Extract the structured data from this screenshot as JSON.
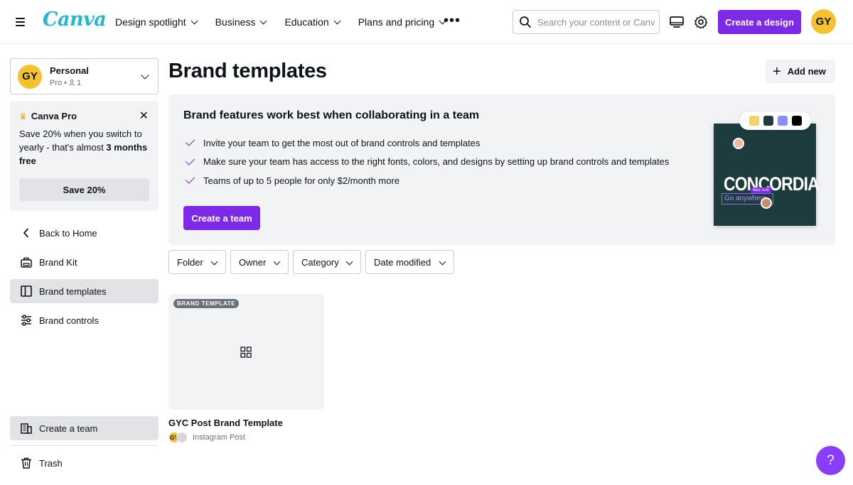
{
  "header": {
    "logo": "Canva",
    "nav": [
      {
        "label": "Design spotlight"
      },
      {
        "label": "Business"
      },
      {
        "label": "Education"
      },
      {
        "label": "Plans and pricing"
      }
    ],
    "search_placeholder": "Search your content or Canva's",
    "create_button": "Create a design",
    "avatar_initials": "GY"
  },
  "sidebar": {
    "account": {
      "initials": "GY",
      "name": "Personal",
      "plan": "Pro • ",
      "members": "1"
    },
    "promo": {
      "title": "Canva Pro",
      "body_prefix": "Save 20% when you switch to yearly - that's almost ",
      "body_bold": "3 months free",
      "button": "Save 20%"
    },
    "items": [
      {
        "label": "Back to Home"
      },
      {
        "label": "Brand Kit"
      },
      {
        "label": "Brand templates"
      },
      {
        "label": "Brand controls"
      }
    ],
    "bottom_items": [
      {
        "label": "Create a team"
      },
      {
        "label": "Trash"
      }
    ]
  },
  "main": {
    "title": "Brand templates",
    "add_button": "Add new",
    "banner": {
      "title": "Brand features work best when collaborating in a team",
      "bullets": [
        "Invite your team to get the most out of brand controls and templates",
        "Make sure your team has access to the right fonts, colors, and designs by setting up brand controls and templates",
        "Teams of up to 5 people for only $2/month more"
      ],
      "button": "Create a team",
      "illustration": {
        "brand_word": "CONCORDIA",
        "tagline": "Go anywhere",
        "cursor_name": "Mary Soto",
        "swatches": [
          "#f5d36b",
          "#1e3b3d",
          "#8b8ef5",
          "#000000"
        ]
      }
    },
    "filters": [
      {
        "label": "Folder"
      },
      {
        "label": "Owner"
      },
      {
        "label": "Category"
      },
      {
        "label": "Date modified"
      }
    ],
    "templates": [
      {
        "badge": "BRAND TEMPLATE",
        "name": "GYC Post Brand Template",
        "type": "Instagram Post",
        "owner_initials": "GY"
      }
    ]
  },
  "help_label": "?",
  "colors": {
    "accent": "#7d2ae8",
    "avatar": "#f4c22f",
    "logo": "#22b7d4"
  }
}
